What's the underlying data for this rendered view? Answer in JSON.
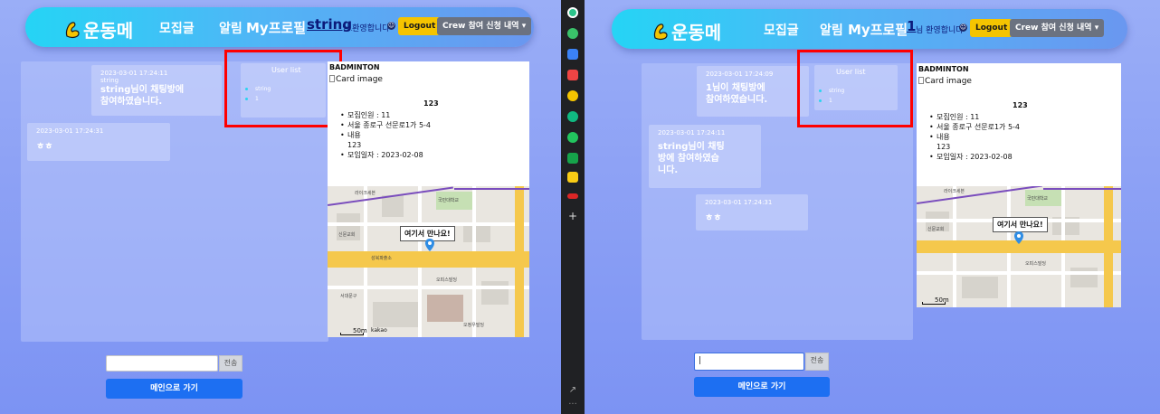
{
  "left": {
    "brand": "운동메",
    "nav_links": [
      "모집글",
      "알림",
      "My프로필"
    ],
    "username": "string",
    "welcome": "님 환영합니다",
    "logout": "Logout",
    "crew_dropdown": "Crew 참여 신청 내역",
    "messages": [
      {
        "time": "2023-03-01 17:24:11",
        "name": "string",
        "text_line1": "string님이 채팅방에",
        "text_line2": "참여하였습니다."
      },
      {
        "time": "2023-03-01 17:24:31",
        "name": "",
        "text_line1": "ㅎㅎ",
        "text_line2": ""
      }
    ],
    "userlist_title": "User list",
    "users": [
      "string",
      "1"
    ],
    "card": {
      "title": "BADMINTON",
      "img_alt": "Card image",
      "number": "123",
      "items": [
        "모집인원 : 11",
        "서울 종로구 선문로1가 5-4",
        "내용",
        "123",
        "모임일자 : 2023-02-08"
      ],
      "map_callout": "여기서 만나요!",
      "map_scale": "50m",
      "map_brand": "kakao"
    },
    "input_value": "",
    "send": "전송",
    "main_btn": "메인으로 가기"
  },
  "right": {
    "brand": "운동메",
    "nav_links": [
      "모집글",
      "알림",
      "My프로필"
    ],
    "username": "1",
    "welcome": "님 환영합니다",
    "logout": "Logout",
    "crew_dropdown": "Crew 참여 신청 내역",
    "messages": [
      {
        "time": "2023-03-01 17:24:09",
        "text_line1": "1님이 채팅방에",
        "text_line2": "참여하였습니다."
      },
      {
        "time": "2023-03-01 17:24:11",
        "text_line1": "string님이 채팅",
        "text_line2": "방에 참여하였습",
        "text_line3": "니다."
      },
      {
        "time": "2023-03-01 17:24:31",
        "text_line1": "ㅎㅎ"
      }
    ],
    "userlist_title": "User list",
    "users": [
      "string",
      "1"
    ],
    "card": {
      "title": "BADMINTON",
      "img_alt": "Card image",
      "number": "123",
      "items": [
        "모집인원 : 11",
        "서울 종로구 선문로1가 5-4",
        "내용",
        "123",
        "모임일자 : 2023-02-08"
      ],
      "map_callout": "여기서 만나요!",
      "map_scale": "50m"
    },
    "input_value": "|",
    "send": "전송",
    "main_btn": "메인으로 가기"
  },
  "sidebar_icons": [
    "extension-icon",
    "green-icon",
    "calendar-icon",
    "pocket-icon",
    "star-icon",
    "edge-icon",
    "play-icon",
    "android-icon",
    "folder-icon",
    "red-icon"
  ],
  "colors": {
    "accent_yellow": "#f5c400",
    "nav_gradient_start": "#25d4f5",
    "nav_gradient_end": "#6a97f0",
    "highlight_red": "#ff0000",
    "button_blue": "#1d6ff2"
  }
}
